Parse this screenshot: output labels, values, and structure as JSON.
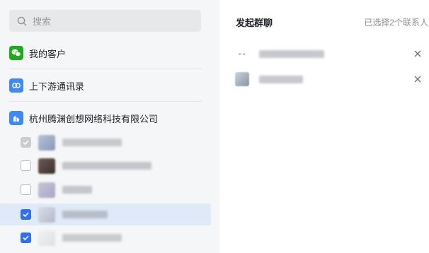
{
  "search": {
    "placeholder": "搜索"
  },
  "nav": [
    {
      "label": "我的客户",
      "icon": "wechat-icon",
      "color": "#1aad19"
    },
    {
      "label": "上下游通讯录",
      "icon": "link-icon",
      "color": "#3d8af7"
    },
    {
      "label": "杭州腾渊创想网络科技有限公司",
      "icon": "company-icon",
      "color": "#3d8af7"
    }
  ],
  "members": [
    {
      "state": "disabled",
      "selected": false
    },
    {
      "state": "unchecked",
      "selected": false
    },
    {
      "state": "unchecked",
      "selected": false
    },
    {
      "state": "checked",
      "selected": true
    },
    {
      "state": "checked",
      "selected": false
    }
  ],
  "right_panel": {
    "title": "发起群聊",
    "count_label": "已选择2个联系人"
  },
  "colors": {
    "accent": "#2f6ff0",
    "selected_row": "#dfe9f7",
    "sidebar_bg": "#f5f6f7"
  }
}
